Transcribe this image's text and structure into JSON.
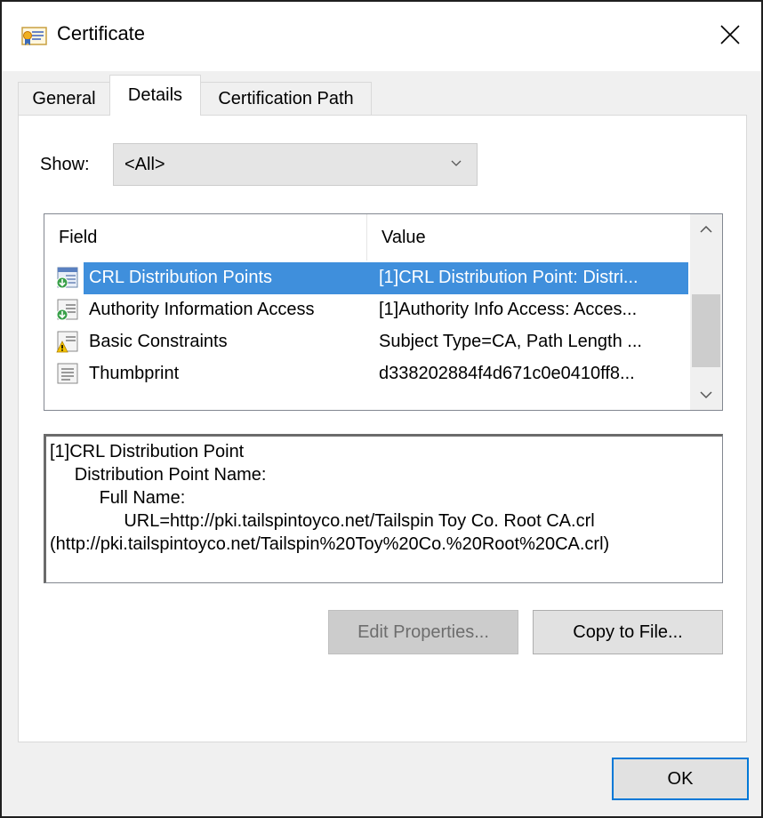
{
  "window": {
    "title": "Certificate",
    "icon": "certificate-icon",
    "close_icon": "close-icon"
  },
  "tabs": [
    {
      "label": "General",
      "active": false
    },
    {
      "label": "Details",
      "active": true
    },
    {
      "label": "Certification Path",
      "active": false
    }
  ],
  "show": {
    "label": "Show:",
    "selected": "<All>",
    "icon": "chevron-down-icon"
  },
  "list": {
    "columns": [
      "Field",
      "Value"
    ],
    "rows": [
      {
        "icon": "certificate-extension-icon",
        "field": "CRL Distribution Points",
        "value": "[1]CRL Distribution Point: Distri...",
        "selected": true
      },
      {
        "icon": "certificate-extension-icon",
        "field": "Authority Information Access",
        "value": "[1]Authority Info Access: Acces...",
        "selected": false
      },
      {
        "icon": "critical-extension-warning-icon",
        "field": "Basic Constraints",
        "value": "Subject Type=CA, Path Length ...",
        "selected": false
      },
      {
        "icon": "certificate-property-icon",
        "field": "Thumbprint",
        "value": "d338202884f4d671c0e0410ff8...",
        "selected": false
      }
    ]
  },
  "details": {
    "text": "[1]CRL Distribution Point\n     Distribution Point Name:\n          Full Name:\n               URL=http://pki.tailspintoyco.net/Tailspin Toy Co. Root CA.crl\n(http://pki.tailspintoyco.net/Tailspin%20Toy%20Co.%20Root%20CA.crl)"
  },
  "buttons": {
    "edit_properties": "Edit Properties...",
    "copy_to_file": "Copy to File...",
    "ok": "OK"
  },
  "colors": {
    "selection": "#3f8fdc",
    "default_button_border": "#0078d7"
  }
}
